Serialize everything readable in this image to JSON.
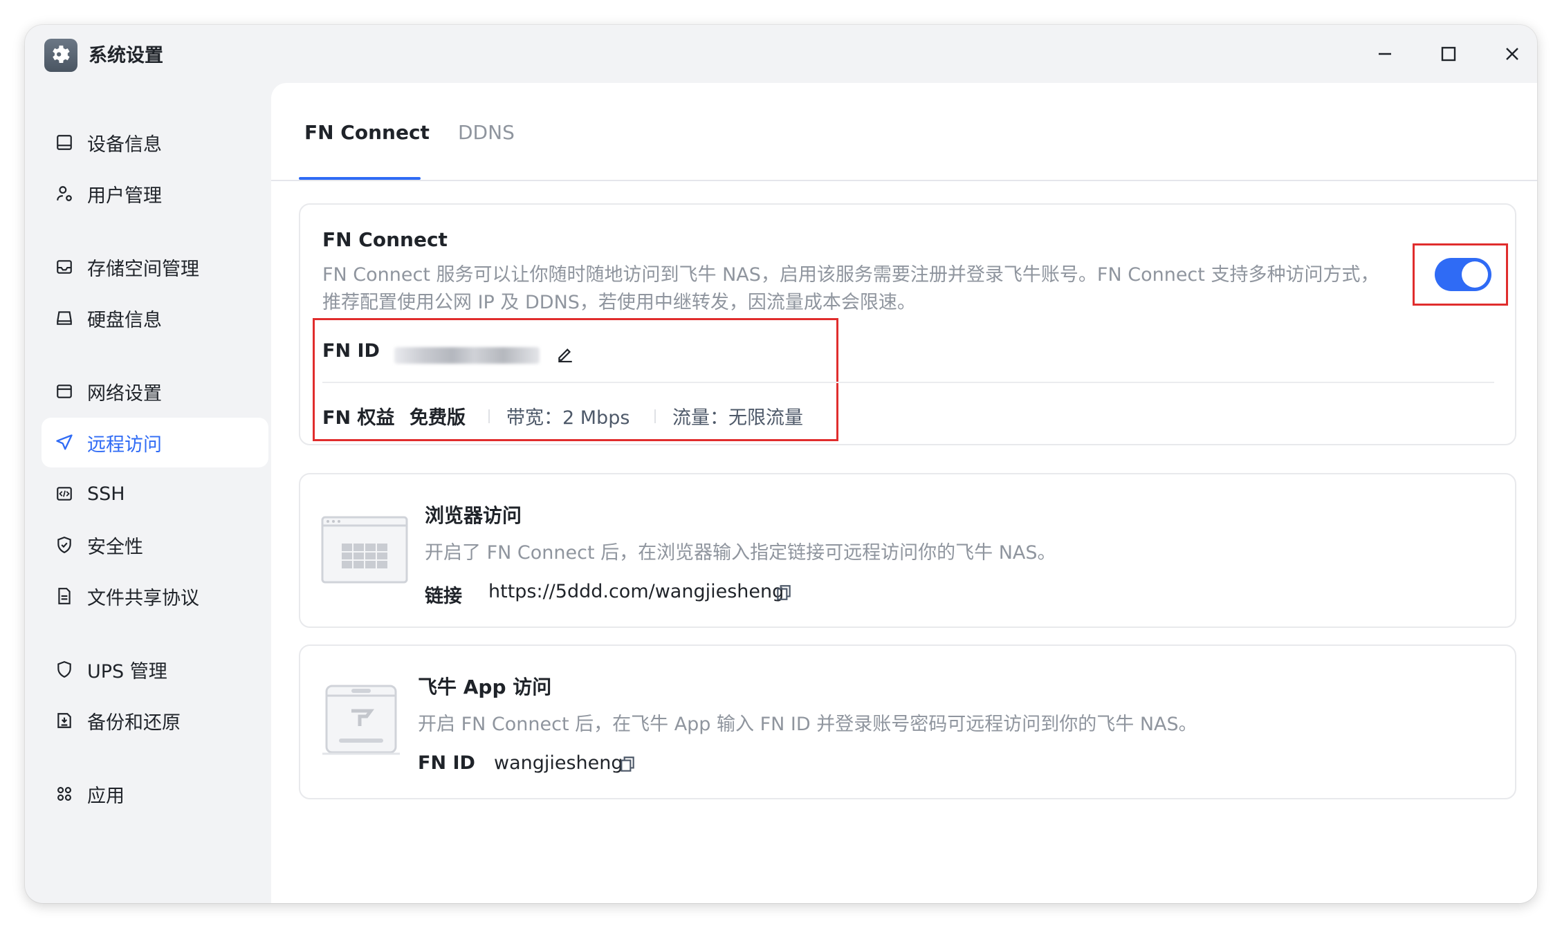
{
  "window": {
    "title": "系统设置",
    "controls": {
      "minimize": "—",
      "maximize": "☐",
      "close": "✕"
    }
  },
  "sidebar": {
    "items": [
      {
        "label": "设备信息",
        "icon": "device-icon"
      },
      {
        "label": "用户管理",
        "icon": "user-icon"
      },
      {
        "label": "存储空间管理",
        "icon": "storage-icon"
      },
      {
        "label": "硬盘信息",
        "icon": "disk-icon"
      },
      {
        "label": "网络设置",
        "icon": "network-icon"
      },
      {
        "label": "远程访问",
        "icon": "send-icon",
        "active": true
      },
      {
        "label": "SSH",
        "icon": "code-icon"
      },
      {
        "label": "安全性",
        "icon": "shield-check-icon"
      },
      {
        "label": "文件共享协议",
        "icon": "file-icon"
      },
      {
        "label": "UPS 管理",
        "icon": "shield-icon"
      },
      {
        "label": "备份和还原",
        "icon": "backup-icon"
      },
      {
        "label": "应用",
        "icon": "apps-icon"
      }
    ]
  },
  "tabs": [
    {
      "label": "FN Connect",
      "active": true
    },
    {
      "label": "DDNS",
      "active": false
    }
  ],
  "fn_connect": {
    "title": "FN Connect",
    "description_line1": "FN Connect 服务可以让你随时随地访问到飞牛 NAS，启用该服务需要注册并登录飞牛账号。FN Connect 支持多种访问方式，",
    "description_line2": "推荐配置使用公网 IP 及 DDNS，若使用中继转发，因流量成本会限速。",
    "enabled": true,
    "fn_id_label": "FN ID",
    "rights_label": "FN 权益",
    "plan": "免费版",
    "bandwidth": "带宽：2 Mbps",
    "traffic": "流量：无限流量"
  },
  "browser_access": {
    "title": "浏览器访问",
    "description": "开启了 FN Connect 后，在浏览器输入指定链接可远程访问你的飞牛 NAS。",
    "link_label": "链接",
    "link": "https://5ddd.com/wangjiesheng"
  },
  "app_access": {
    "title": "飞牛 App 访问",
    "description": "开启 FN Connect 后，在飞牛 App 输入 FN ID 并登录账号密码可远程访问到你的飞牛 NAS。",
    "id_label": "FN ID",
    "id_value": "wangjiesheng"
  },
  "colors": {
    "accent": "#2f6bf5",
    "highlight": "#e02d2d",
    "muted_text": "#8f959e",
    "sidebar_bg": "#f2f3f5"
  }
}
